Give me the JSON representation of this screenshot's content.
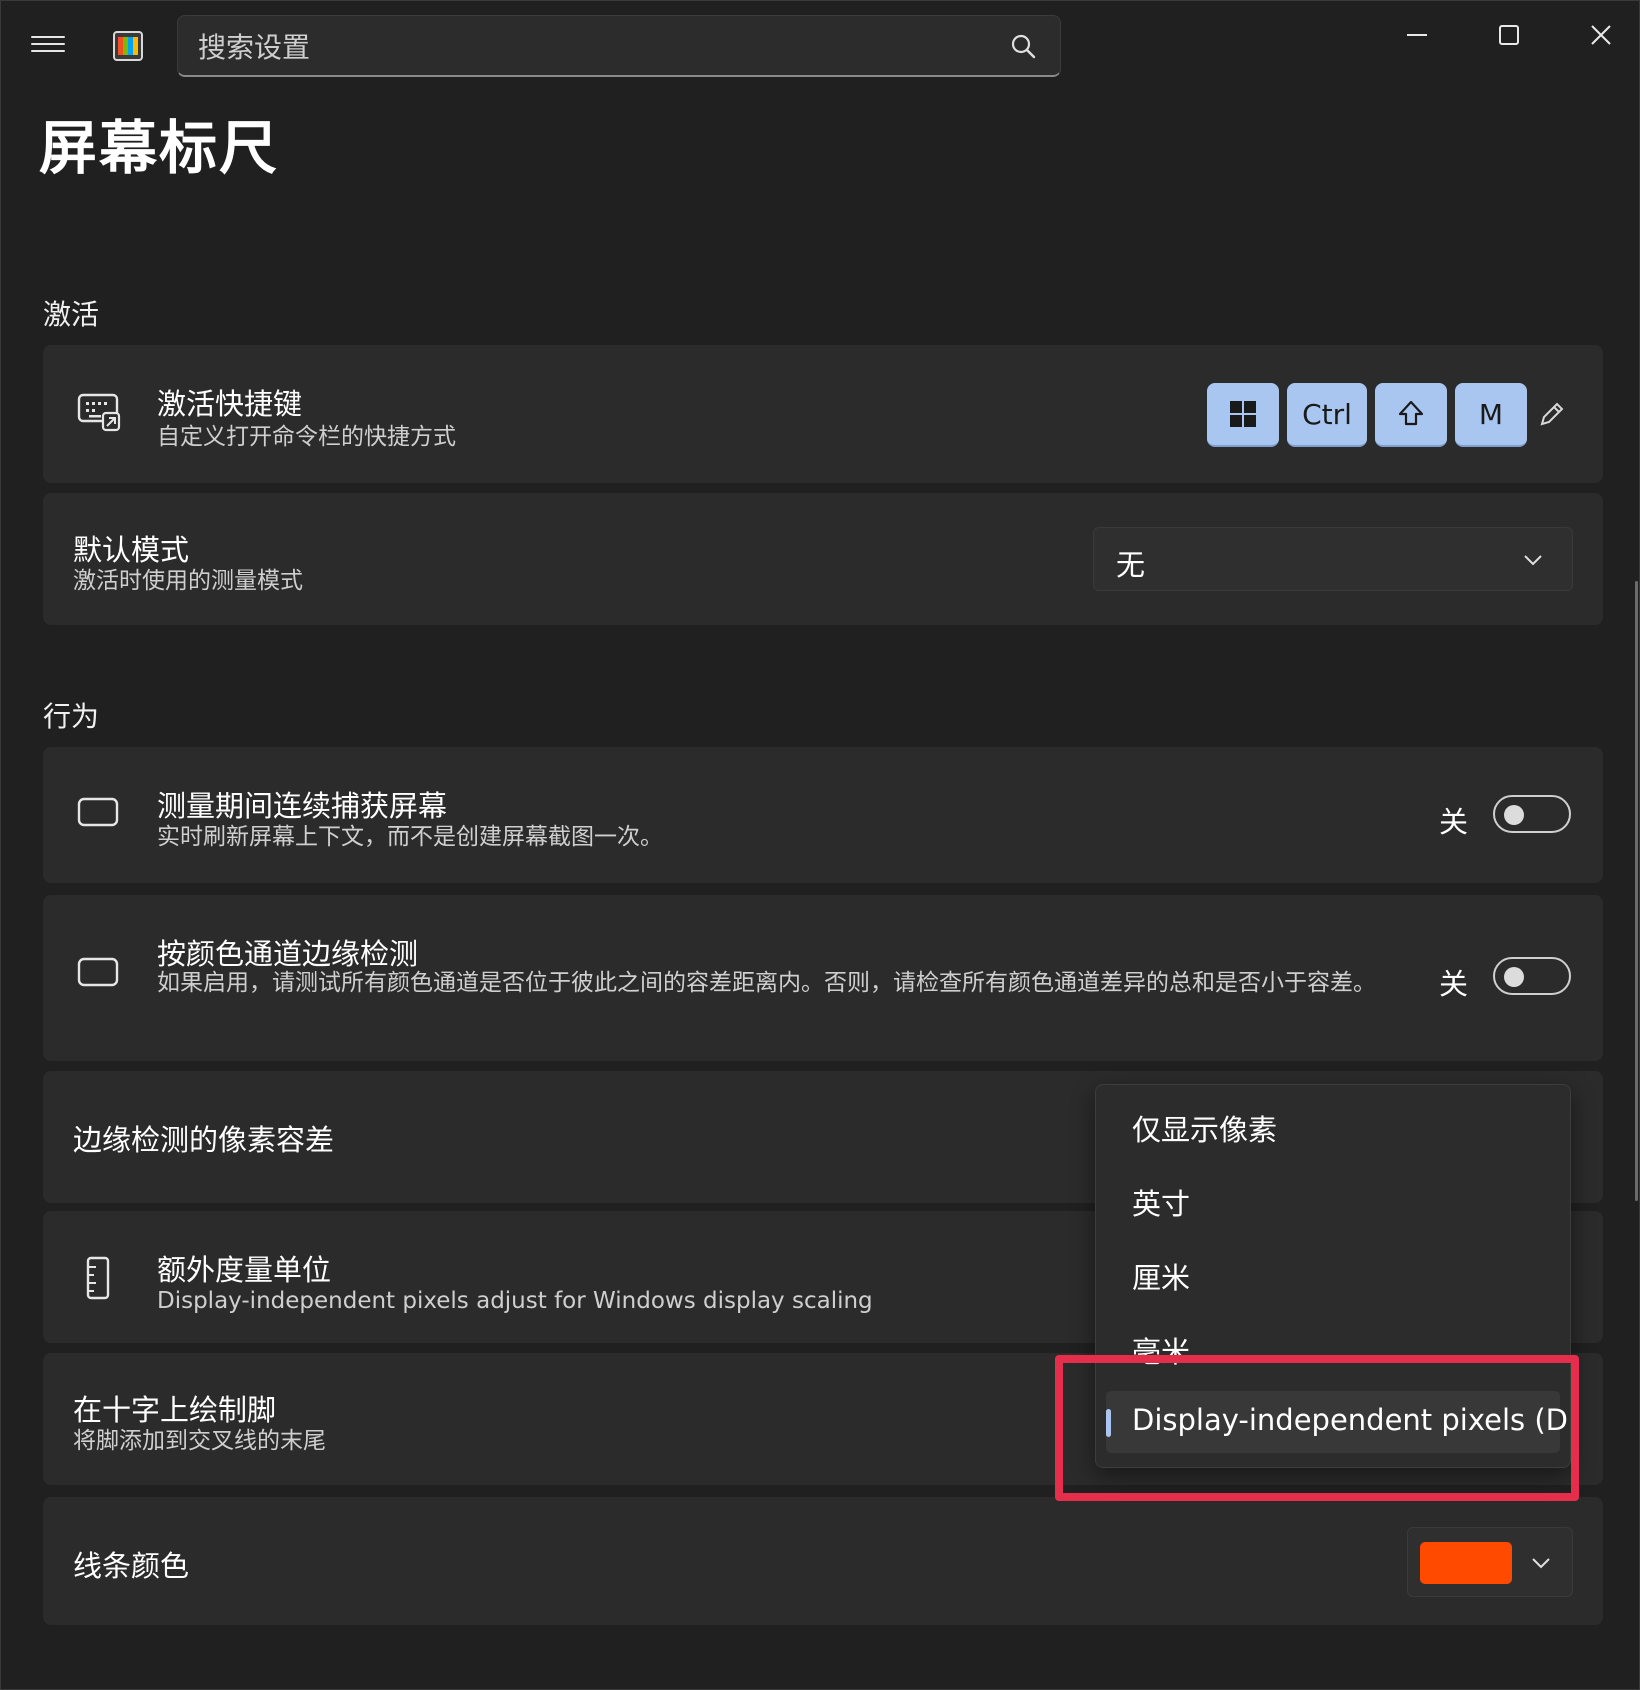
{
  "search": {
    "placeholder": "搜索设置"
  },
  "page": {
    "title": "屏幕标尺"
  },
  "sections": {
    "activation": "激活",
    "behavior": "行为"
  },
  "activation_shortcut": {
    "title": "激活快捷键",
    "description": "自定义打开命令栏的快捷方式",
    "keys": [
      "win-logo",
      "Ctrl",
      "shift-arrow",
      "M"
    ]
  },
  "default_mode": {
    "title": "默认模式",
    "description": "激活时使用的测量模式",
    "value": "无"
  },
  "continuous_capture": {
    "title": "测量期间连续捕获屏幕",
    "description": "实时刷新屏幕上下文，而不是创建屏幕截图一次。",
    "state": "关"
  },
  "per_channel_edge": {
    "title": "按颜色通道边缘检测",
    "description": "如果启用，请测试所有颜色通道是否位于彼此之间的容差距离内。否则，请检查所有颜色通道差异的总和是否小于容差。",
    "state": "关"
  },
  "pixel_tolerance": {
    "title": "边缘检测的像素容差"
  },
  "extra_units": {
    "title": "额外度量单位",
    "description": "Display-independent pixels adjust for Windows display scaling"
  },
  "draw_feet": {
    "title": "在十字上绘制脚",
    "description": "将脚添加到交叉线的末尾"
  },
  "line_color": {
    "title": "线条颜色",
    "value": "#ff4a00"
  },
  "units_dropdown": {
    "options": [
      "仅显示像素",
      "英寸",
      "厘米",
      "毫米",
      "Display-independent pixels (DIP)"
    ],
    "selected": "Display-independent pixels (DIP)"
  },
  "colors": {
    "background": "#202020",
    "card": "#2b2b2b",
    "accent": "#a9c6f0",
    "highlight": "#e52e4c"
  }
}
